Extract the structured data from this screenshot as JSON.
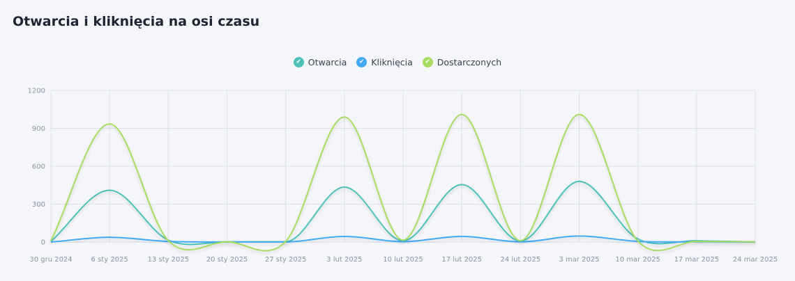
{
  "title": "Otwarcia i kliknięcia na osi czasu",
  "legend": [
    {
      "label": "Otwarcia",
      "color": "#4cc1b8",
      "check": "✔"
    },
    {
      "label": "Kliknięcia",
      "color": "#40a9f0",
      "check": "✔"
    },
    {
      "label": "Dostarczonych",
      "color": "#a6dc61",
      "check": "✔"
    }
  ],
  "chart_data": {
    "type": "line",
    "smooth": true,
    "categories": [
      "30 gru 2024",
      "6 sty 2025",
      "13 sty 2025",
      "20 sty 2025",
      "27 sty 2025",
      "3 lut 2025",
      "10 lut 2025",
      "17 lut 2025",
      "24 lut 2025",
      "3 mar 2025",
      "10 mar 2025",
      "17 mar 2025",
      "24 mar 2025"
    ],
    "yticks": [
      0,
      300,
      600,
      900,
      1200
    ],
    "ylim": [
      0,
      1200
    ],
    "grid": true,
    "legend_position": "top-center",
    "series": [
      {
        "name": "Otwarcia",
        "color": "#4cc1b8",
        "values": [
          5,
          410,
          15,
          2,
          2,
          435,
          10,
          455,
          8,
          480,
          25,
          10,
          2
        ]
      },
      {
        "name": "Kliknięcia",
        "color": "#40a9f0",
        "values": [
          0,
          38,
          5,
          1,
          1,
          45,
          3,
          45,
          2,
          48,
          5,
          2,
          0
        ]
      },
      {
        "name": "Dostarczonych",
        "color": "#a6dc61",
        "values": [
          10,
          935,
          10,
          2,
          5,
          990,
          15,
          1010,
          10,
          1010,
          8,
          5,
          2
        ]
      }
    ]
  }
}
